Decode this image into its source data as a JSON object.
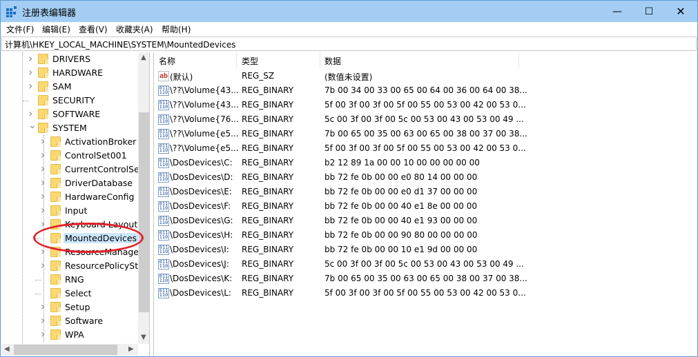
{
  "window": {
    "title": "注册表编辑器",
    "icon": "registry-editor-icon"
  },
  "menu": [
    "文件(F)",
    "编辑(E)",
    "查看(V)",
    "收藏夹(A)",
    "帮助(H)"
  ],
  "address": "计算机\\HKEY_LOCAL_MACHINE\\SYSTEM\\MountedDevices",
  "tree": [
    {
      "label": "DRIVERS",
      "level": 1,
      "expander": "collapsed"
    },
    {
      "label": "HARDWARE",
      "level": 1,
      "expander": "collapsed"
    },
    {
      "label": "SAM",
      "level": 1,
      "expander": "collapsed"
    },
    {
      "label": "SECURITY",
      "level": 1,
      "expander": "none"
    },
    {
      "label": "SOFTWARE",
      "level": 1,
      "expander": "collapsed"
    },
    {
      "label": "SYSTEM",
      "level": 1,
      "expander": "expanded"
    },
    {
      "label": "ActivationBroker",
      "level": 2,
      "expander": "collapsed"
    },
    {
      "label": "ControlSet001",
      "level": 2,
      "expander": "collapsed"
    },
    {
      "label": "CurrentControlSet",
      "level": 2,
      "expander": "collapsed"
    },
    {
      "label": "DriverDatabase",
      "level": 2,
      "expander": "collapsed"
    },
    {
      "label": "HardwareConfig",
      "level": 2,
      "expander": "collapsed"
    },
    {
      "label": "Input",
      "level": 2,
      "expander": "collapsed"
    },
    {
      "label": "Keyboard Layout",
      "level": 2,
      "expander": "collapsed"
    },
    {
      "label": "MountedDevices",
      "level": 2,
      "expander": "none",
      "selected": true
    },
    {
      "label": "ResourceManager",
      "level": 2,
      "expander": "collapsed"
    },
    {
      "label": "ResourcePolicySto",
      "level": 2,
      "expander": "collapsed"
    },
    {
      "label": "RNG",
      "level": 2,
      "expander": "none"
    },
    {
      "label": "Select",
      "level": 2,
      "expander": "none"
    },
    {
      "label": "Setup",
      "level": 2,
      "expander": "collapsed"
    },
    {
      "label": "Software",
      "level": 2,
      "expander": "collapsed"
    },
    {
      "label": "WPA",
      "level": 2,
      "expander": "collapsed"
    }
  ],
  "columns": {
    "name": "名称",
    "type": "类型",
    "data": "数据"
  },
  "values": [
    {
      "icon": "string-value-icon",
      "name": "(默认)",
      "type": "REG_SZ",
      "data": "(数值未设置)"
    },
    {
      "icon": "binary-value-icon",
      "name": "\\??\\Volume{43...",
      "type": "REG_BINARY",
      "data": "7b 00 34 00 33 00 65 00 64 00 36 00 64 00 38..."
    },
    {
      "icon": "binary-value-icon",
      "name": "\\??\\Volume{43...",
      "type": "REG_BINARY",
      "data": "5f 00 3f 00 3f 00 5f 00 55 00 53 00 42 00 53 0..."
    },
    {
      "icon": "binary-value-icon",
      "name": "\\??\\Volume{76...",
      "type": "REG_BINARY",
      "data": "5c 00 3f 00 3f 00 5c 00 53 00 43 00 53 00 49 ..."
    },
    {
      "icon": "binary-value-icon",
      "name": "\\??\\Volume{e5...",
      "type": "REG_BINARY",
      "data": "7b 00 65 00 35 00 63 00 65 00 38 00 37 00 38..."
    },
    {
      "icon": "binary-value-icon",
      "name": "\\??\\Volume{e5...",
      "type": "REG_BINARY",
      "data": "5f 00 3f 00 3f 00 5f 00 55 00 53 00 42 00 53 0..."
    },
    {
      "icon": "binary-value-icon",
      "name": "\\DosDevices\\C:",
      "type": "REG_BINARY",
      "data": "b2 12 89 1a 00 00 10 00 00 00 00 00"
    },
    {
      "icon": "binary-value-icon",
      "name": "\\DosDevices\\D:",
      "type": "REG_BINARY",
      "data": "bb 72 fe 0b 00 00 e0 80 14 00 00 00"
    },
    {
      "icon": "binary-value-icon",
      "name": "\\DosDevices\\E:",
      "type": "REG_BINARY",
      "data": "bb 72 fe 0b 00 00 e0 d1 37 00 00 00"
    },
    {
      "icon": "binary-value-icon",
      "name": "\\DosDevices\\F:",
      "type": "REG_BINARY",
      "data": "bb 72 fe 0b 00 00 40 e1 8e 00 00 00"
    },
    {
      "icon": "binary-value-icon",
      "name": "\\DosDevices\\G:",
      "type": "REG_BINARY",
      "data": "bb 72 fe 0b 00 00 40 e1 93 00 00 00"
    },
    {
      "icon": "binary-value-icon",
      "name": "\\DosDevices\\H:",
      "type": "REG_BINARY",
      "data": "bb 72 fe 0b 00 00 90 80 00 00 00 00"
    },
    {
      "icon": "binary-value-icon",
      "name": "\\DosDevices\\I:",
      "type": "REG_BINARY",
      "data": "bb 72 fe 0b 00 00 10 e1 9d 00 00 00"
    },
    {
      "icon": "binary-value-icon",
      "name": "\\DosDevices\\J:",
      "type": "REG_BINARY",
      "data": "5c 00 3f 00 3f 00 5c 00 53 00 43 00 53 00 49 ..."
    },
    {
      "icon": "binary-value-icon",
      "name": "\\DosDevices\\K:",
      "type": "REG_BINARY",
      "data": "7b 00 65 00 35 00 63 00 65 00 38 00 37 00 38..."
    },
    {
      "icon": "binary-value-icon",
      "name": "\\DosDevices\\L:",
      "type": "REG_BINARY",
      "data": "5f 00 3f 00 3f 00 5f 00 55 00 53 00 42 00 53 0..."
    }
  ],
  "colors": {
    "titlebar": "#a3cdf3",
    "selection": "#cce8ff",
    "annotation": "#e0222a"
  }
}
